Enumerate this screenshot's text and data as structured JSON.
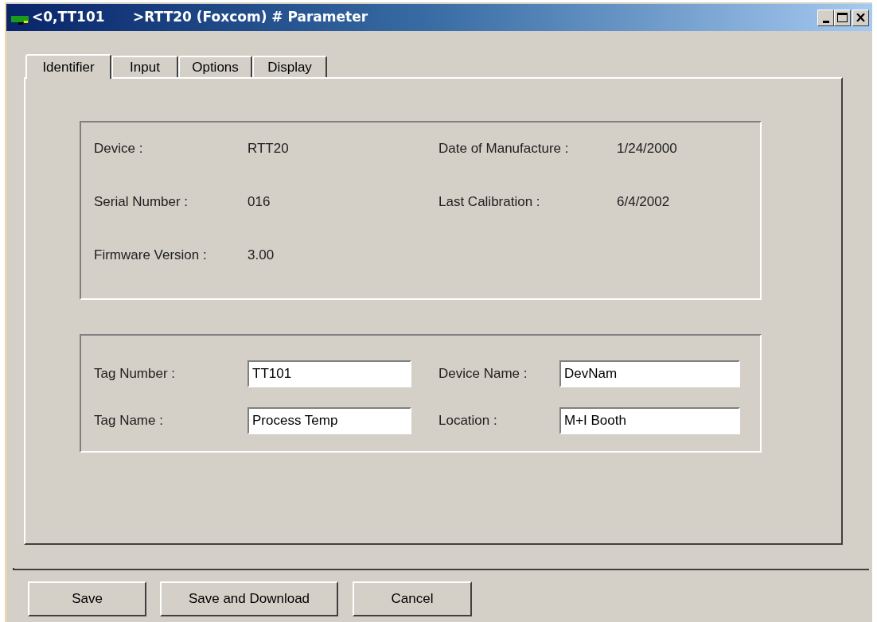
{
  "window": {
    "title": "<0,TT101      >RTT20 (Foxcom) # Parameter"
  },
  "tabs": [
    {
      "label": "Identifier",
      "selected": true
    },
    {
      "label": "Input",
      "selected": false
    },
    {
      "label": "Options",
      "selected": false
    },
    {
      "label": "Display",
      "selected": false
    }
  ],
  "device_info": {
    "rows": [
      [
        {
          "label": "Device :",
          "value": "RTT20"
        },
        {
          "label": "Date of Manufacture :",
          "value": "1/24/2000"
        }
      ],
      [
        {
          "label": "Serial Number :",
          "value": "016"
        },
        {
          "label": "Last Calibration :",
          "value": "6/4/2002"
        }
      ],
      [
        {
          "label": "Firmware Version :",
          "value": "3.00"
        }
      ]
    ]
  },
  "tag_fields": {
    "rows": [
      [
        {
          "label": "Tag Number :",
          "value": "TT101"
        },
        {
          "label": "Device Name :",
          "value": "DevNam"
        }
      ],
      [
        {
          "label": "Tag Name :",
          "value": "Process Temp"
        },
        {
          "label": "Location :",
          "value": "M+I Booth"
        }
      ]
    ]
  },
  "buttons": [
    {
      "label": "Save"
    },
    {
      "label": "Save and Download"
    },
    {
      "label": "Cancel"
    }
  ]
}
